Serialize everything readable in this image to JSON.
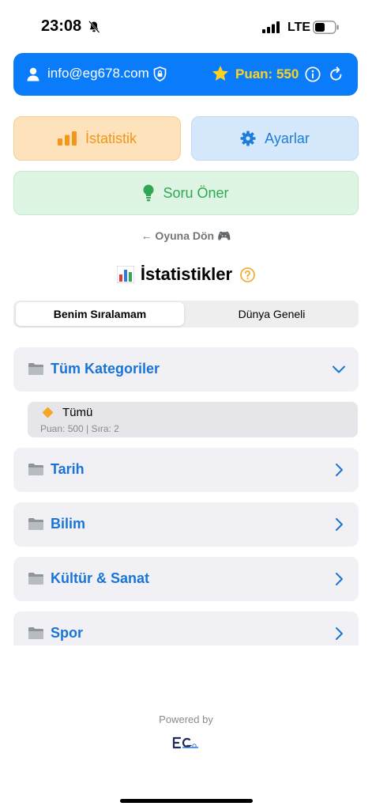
{
  "status_bar": {
    "time": "23:08",
    "network": "LTE"
  },
  "user_bar": {
    "email": "info@eg678.com",
    "points_label": "Puan: 550"
  },
  "menu": {
    "stats_label": "İstatistik",
    "settings_label": "Ayarlar",
    "suggest_label": "Soru Öner"
  },
  "back_link": "← Oyuna Dön 🎮",
  "section": {
    "title": "İstatistikler"
  },
  "tabs": {
    "mine": "Benim Sıralamam",
    "world": "Dünya Geneli"
  },
  "categories": [
    {
      "label": "Tüm Kategoriler",
      "expanded": true
    },
    {
      "label": "Tarih",
      "expanded": false
    },
    {
      "label": "Bilim",
      "expanded": false
    },
    {
      "label": "Kültür & Sanat",
      "expanded": false
    },
    {
      "label": "Spor",
      "expanded": false
    }
  ],
  "sub_item": {
    "name": "Tümü",
    "meta": "Puan: 500 | Sıra: 2"
  },
  "footer": {
    "powered_by": "Powered by"
  },
  "colors": {
    "accent_blue": "#0a7cfa",
    "points_yellow": "#ffd21f",
    "stats_orange": "#f3961a",
    "suggest_green": "#2fa853"
  }
}
